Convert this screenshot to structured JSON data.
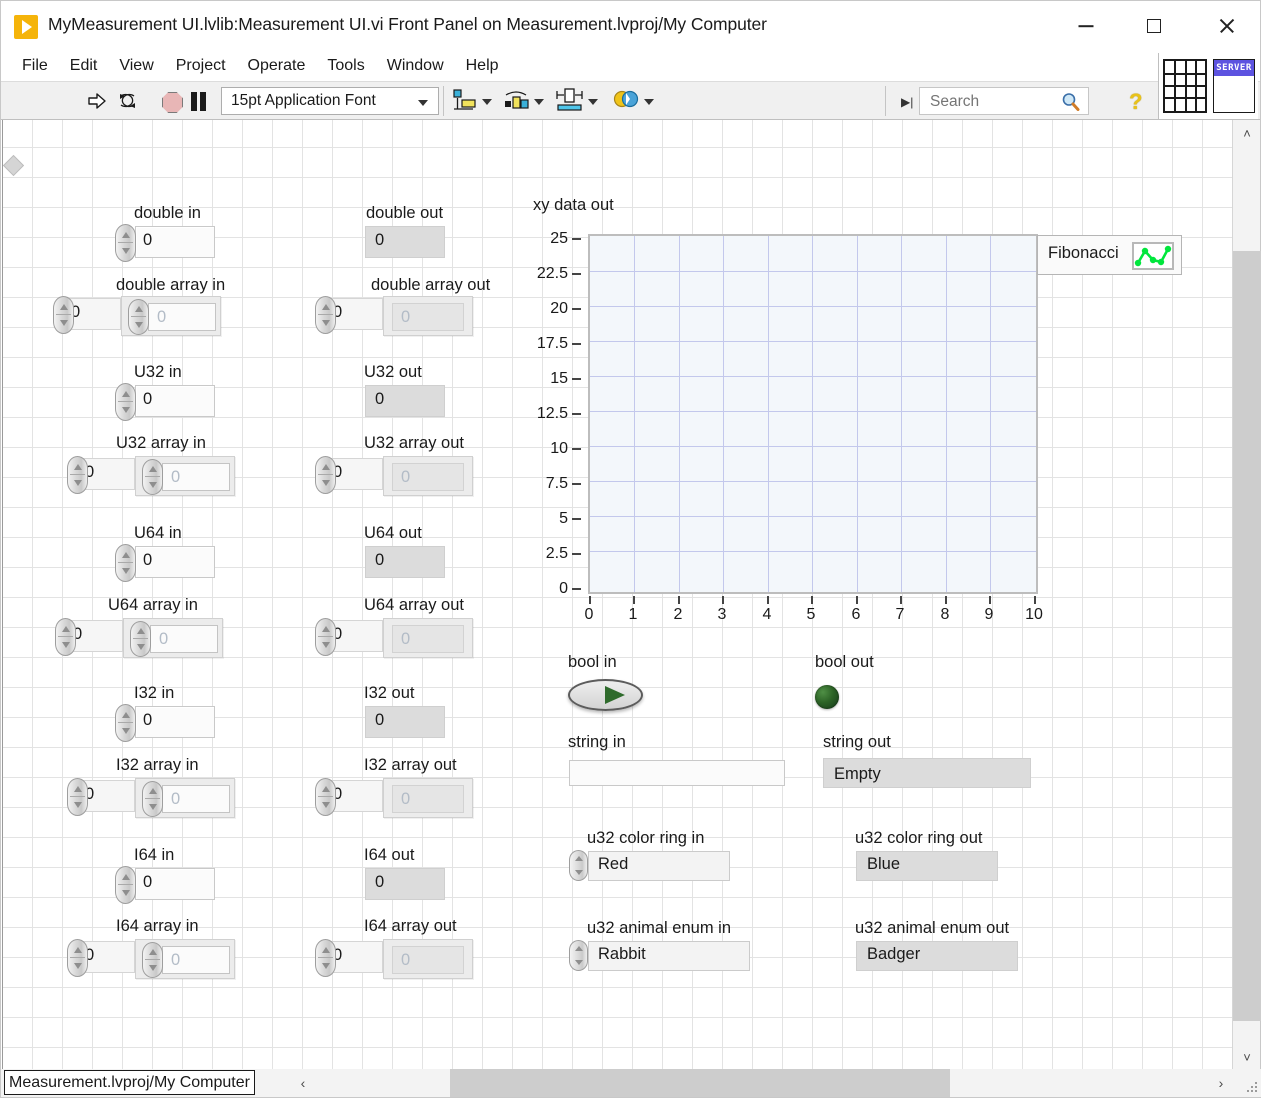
{
  "window": {
    "title": "MyMeasurement UI.lvlib:Measurement UI.vi Front Panel on Measurement.lvproj/My Computer",
    "app_icon": "labview-vi-icon",
    "minimize": "minimize-icon",
    "maximize": "maximize-icon",
    "close": "close-icon"
  },
  "menu": {
    "items": [
      "File",
      "Edit",
      "View",
      "Project",
      "Operate",
      "Tools",
      "Window",
      "Help"
    ]
  },
  "toolbar": {
    "run": "run-arrow-icon",
    "run_continuously": "run-continuously-icon",
    "abort": "abort-execution-icon",
    "pause": "pause-icon",
    "font_selector": "15pt Application Font",
    "align_objects": "align-objects-icon",
    "distribute_objects": "distribute-objects-icon",
    "resize_objects": "resize-objects-icon",
    "reorder_objects": "reorder-objects-icon",
    "search_placeholder": "Search",
    "search_value": "",
    "search_icon": "magnifier-icon",
    "help_icon": "context-help-icon",
    "server_label": "SERVER"
  },
  "panel": {
    "inputs": [
      {
        "label": "double in",
        "value": "0",
        "kind": "numeric"
      },
      {
        "label": "double array in",
        "value": "0",
        "index": "0",
        "kind": "array"
      },
      {
        "label": "U32 in",
        "value": "0",
        "kind": "numeric"
      },
      {
        "label": "U32 array in",
        "value": "0",
        "index": "0",
        "kind": "array"
      },
      {
        "label": "U64 in",
        "value": "0",
        "kind": "numeric"
      },
      {
        "label": "U64 array in",
        "value": "0",
        "index": "0",
        "kind": "array"
      },
      {
        "label": "I32 in",
        "value": "0",
        "kind": "numeric"
      },
      {
        "label": "I32 array in",
        "value": "0",
        "index": "0",
        "kind": "array"
      },
      {
        "label": "I64 in",
        "value": "0",
        "kind": "numeric"
      },
      {
        "label": "I64 array in",
        "value": "0",
        "index": "0",
        "kind": "array"
      }
    ],
    "outputs": [
      {
        "label": "double out",
        "value": "0",
        "kind": "numeric"
      },
      {
        "label": "double array out",
        "value": "0",
        "index": "0",
        "kind": "array"
      },
      {
        "label": "U32 out",
        "value": "0",
        "kind": "numeric"
      },
      {
        "label": "U32 array out",
        "value": "0",
        "index": "0",
        "kind": "array"
      },
      {
        "label": "U64 out",
        "value": "0",
        "kind": "numeric"
      },
      {
        "label": "U64 array out",
        "value": "0",
        "index": "0",
        "kind": "array"
      },
      {
        "label": "I32 out",
        "value": "0",
        "kind": "numeric"
      },
      {
        "label": "I32 array out",
        "value": "0",
        "index": "0",
        "kind": "array"
      },
      {
        "label": "I64 out",
        "value": "0",
        "kind": "numeric"
      },
      {
        "label": "I64 array out",
        "value": "0",
        "index": "0",
        "kind": "array"
      }
    ],
    "bool_in": {
      "label": "bool in",
      "state": "off",
      "icon": "toggle-switch-icon"
    },
    "bool_out": {
      "label": "bool out",
      "state": "off",
      "icon": "round-led-icon"
    },
    "string_in": {
      "label": "string in",
      "value": "",
      "placeholder": ""
    },
    "string_out": {
      "label": "string out",
      "value": "Empty"
    },
    "color_ring_in": {
      "label": "u32 color ring in",
      "value": "Red"
    },
    "color_ring_out": {
      "label": "u32 color ring out",
      "value": "Blue"
    },
    "animal_enum_in": {
      "label": "u32 animal enum in",
      "value": "Rabbit"
    },
    "animal_enum_out": {
      "label": "u32 animal enum out",
      "value": "Badger"
    }
  },
  "chart_data": {
    "type": "scatter",
    "title": "xy data out",
    "xlabel": "",
    "ylabel": "",
    "xlim": [
      0,
      10
    ],
    "ylim": [
      0,
      25
    ],
    "xticks": [
      "0",
      "1",
      "2",
      "3",
      "4",
      "5",
      "6",
      "7",
      "8",
      "9",
      "10"
    ],
    "yticks": [
      "0",
      "2.5",
      "5",
      "7.5",
      "10",
      "12.5",
      "15",
      "17.5",
      "20",
      "22.5",
      "25"
    ],
    "grid": true,
    "legend_position": "top-right-outside",
    "series": [
      {
        "name": "Fibonacci",
        "color": "#00e63c",
        "x": [],
        "y": []
      }
    ]
  },
  "statusbar": {
    "target": "Measurement.lvproj/My Computer",
    "scroll_left": "‹",
    "scroll_right": "›"
  },
  "scrollbars": {
    "v_up": "˄",
    "v_down": "˅"
  },
  "colors": {
    "accent_yellow": "#f5b40a",
    "plot_green": "#00e63c",
    "grid_line": "#c3c8ec",
    "plot_bg": "#f3f7fb",
    "server_blue": "#5d53e0"
  }
}
